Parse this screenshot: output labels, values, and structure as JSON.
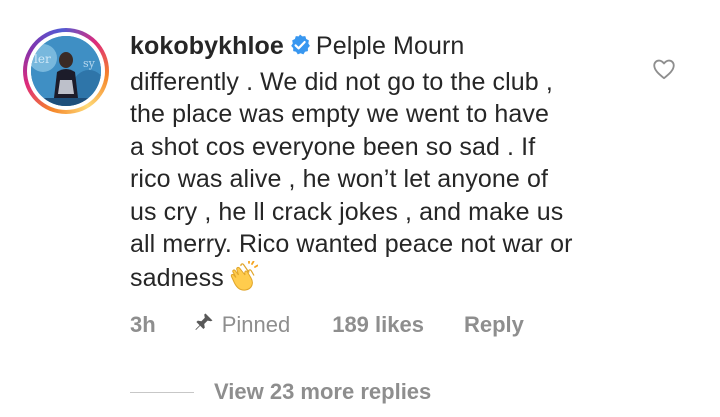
{
  "comment": {
    "username": "kokobykhloe",
    "verified": true,
    "text_lines": [
      "Pelple Mourn",
      "differently . We did not go to the club ,",
      "the place was empty we went to have",
      "a shot cos everyone been so sad . If",
      "rico was alive , he won’t let anyone of",
      "us cry , he ll crack jokes , and make us",
      "all merry. Rico wanted peace not war or",
      "sadness"
    ],
    "emoji": "clapping-hands-emoji",
    "avatar_icon": "profile-photo",
    "like_icon": "heart-outline-icon"
  },
  "meta": {
    "time": "3h",
    "pinned_label": "Pinned",
    "pin_icon": "pin-icon",
    "likes": "189 likes",
    "reply_label": "Reply"
  },
  "replies": {
    "label": "View 23 more replies"
  },
  "colors": {
    "text": "#262626",
    "secondary": "#8e8e8e",
    "verified_blue": "#3897f0",
    "ring_gradient": [
      "#f58529",
      "#dd2a7b",
      "#8134af",
      "#515bd4",
      "#feda77"
    ]
  }
}
